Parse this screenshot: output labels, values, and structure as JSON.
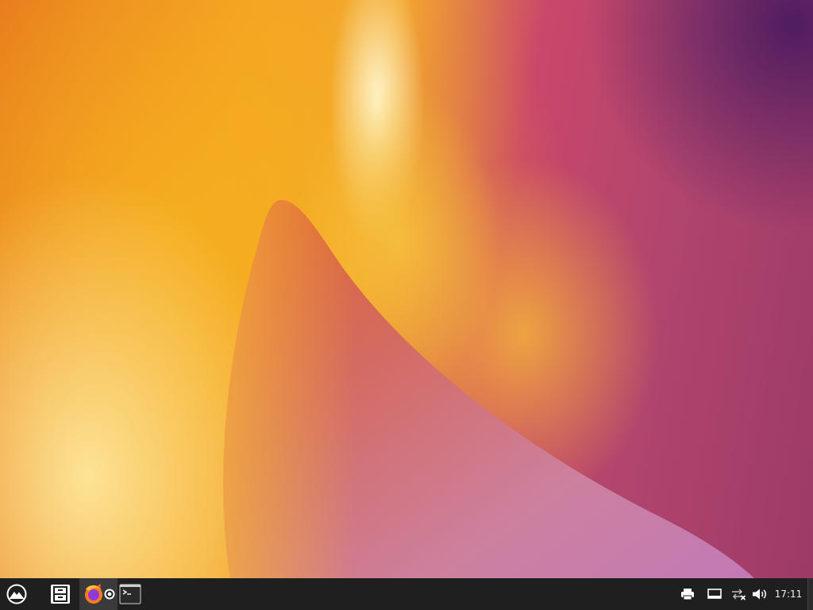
{
  "wallpaper": {
    "colors": {
      "orange": "#e36d1e",
      "yellow": "#f4b22a",
      "magenta": "#b0456e",
      "purple": "#46195f",
      "pink_fin": "#cd7d9d"
    }
  },
  "taskbar": {
    "start_button": {
      "icon": "app-menu-icon"
    },
    "launchers": [
      {
        "name": "files",
        "icon": "file-cabinet-icon"
      },
      {
        "name": "firefox",
        "icon": "firefox-icon",
        "active": true
      },
      {
        "name": "terminal",
        "icon": "terminal-icon"
      }
    ],
    "tray": [
      {
        "name": "printer",
        "icon": "printer-icon"
      },
      {
        "name": "display",
        "icon": "display-icon"
      },
      {
        "name": "network",
        "icon": "network-disconnected-icon"
      },
      {
        "name": "volume",
        "icon": "volume-icon"
      }
    ],
    "clock": "17:11",
    "background": "#1f1f1f"
  }
}
